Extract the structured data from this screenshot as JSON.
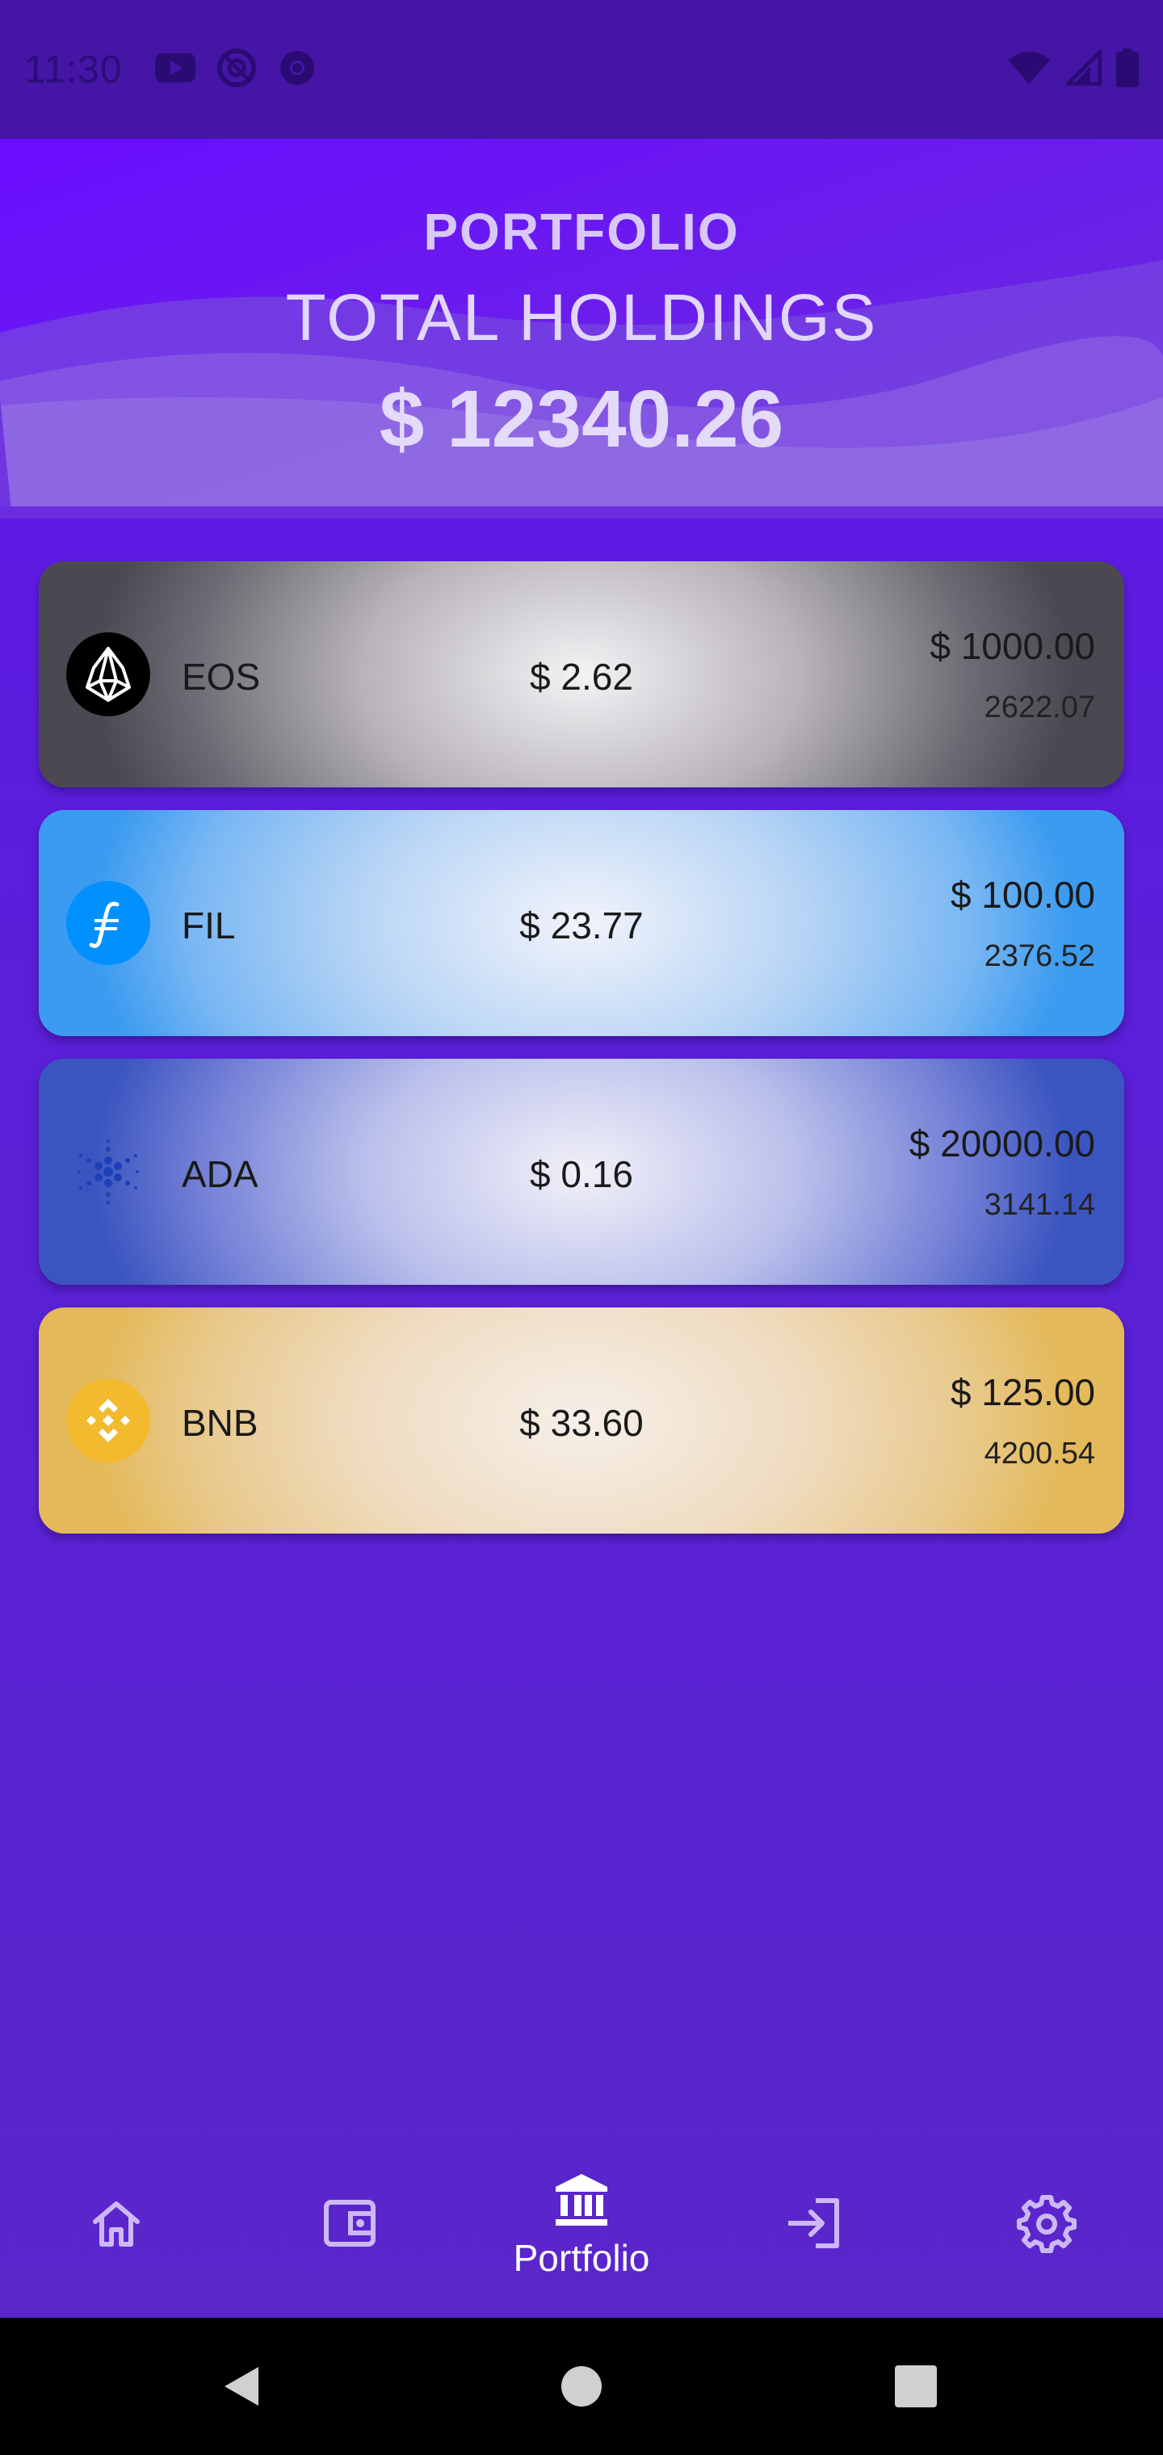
{
  "status_bar": {
    "time": "11:30",
    "left_icons": [
      "youtube-icon",
      "vpn-icon",
      "chrome-icon"
    ],
    "right_icons": [
      "wifi-icon",
      "signal-icon",
      "battery-icon"
    ]
  },
  "header": {
    "title": "PORTFOLIO",
    "holdings_label": "TOTAL HOLDINGS",
    "holdings_value": "$ 12340.26"
  },
  "coins": [
    {
      "symbol": "EOS",
      "price": "$ 2.62",
      "amount": "$ 1000.00",
      "quantity": "2622.07",
      "icon": "eos-icon",
      "icon_bg": "#000000"
    },
    {
      "symbol": "FIL",
      "price": "$ 23.77",
      "amount": "$ 100.00",
      "quantity": "2376.52",
      "icon": "filecoin-icon",
      "icon_bg": "#0090ff"
    },
    {
      "symbol": "ADA",
      "price": "$ 0.16",
      "amount": "$ 20000.00",
      "quantity": "3141.14",
      "icon": "cardano-icon",
      "icon_bg": "transparent"
    },
    {
      "symbol": "BNB",
      "price": "$ 33.60",
      "amount": "$ 125.00",
      "quantity": "4200.54",
      "icon": "binance-icon",
      "icon_bg": "#f3ba2f"
    }
  ],
  "bottom_nav": {
    "items": [
      {
        "icon": "home-icon",
        "label": ""
      },
      {
        "icon": "wallet-icon",
        "label": ""
      },
      {
        "icon": "bank-icon",
        "label": "Portfolio",
        "active": true
      },
      {
        "icon": "login-icon",
        "label": ""
      },
      {
        "icon": "gear-icon",
        "label": ""
      }
    ]
  },
  "colors": {
    "background": "#5a1fd8",
    "status_bar": "#4515a6",
    "nav_icon": "#cbb8f5",
    "nav_active": "#ffffff"
  }
}
